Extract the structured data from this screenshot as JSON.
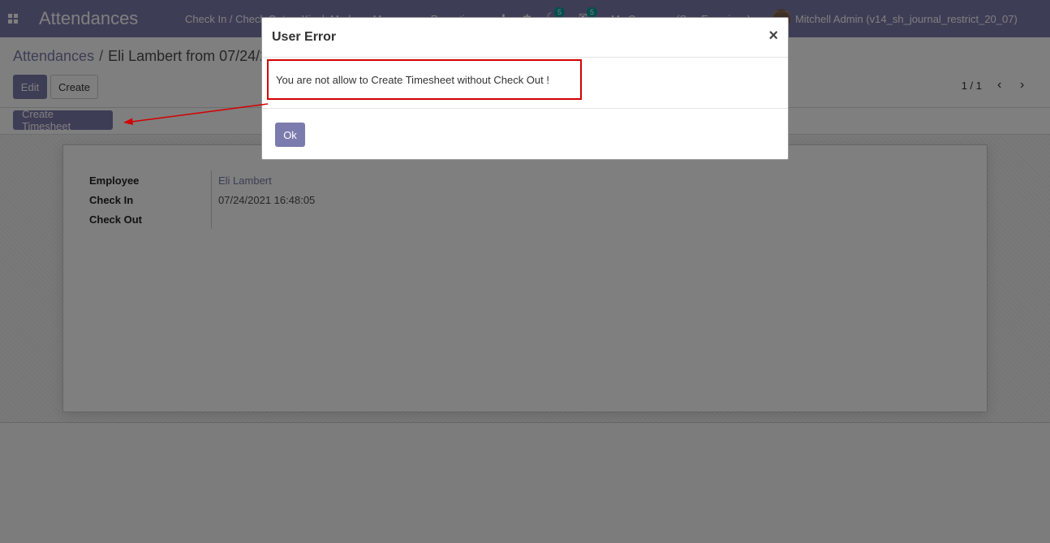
{
  "navbar": {
    "app_title": "Attendances",
    "menu": [
      "Check In / Check Out",
      "Kiosk Mode",
      "Manager",
      "Reporting"
    ],
    "activity_badge": "5",
    "messages_badge": "5",
    "company": "My Company (San Francisco)",
    "user": "Mitchell Admin (v14_sh_journal_restrict_20_07)"
  },
  "breadcrumb": {
    "parent": "Attendances",
    "separator": "/",
    "current": "Eli Lambert from 07/24/2021 16:48:05"
  },
  "buttons": {
    "edit": "Edit",
    "create": "Create",
    "create_timesheet": "Create Timesheet"
  },
  "pager": {
    "value": "1 / 1",
    "prev_icon": "chevron-left-icon",
    "next_icon": "chevron-right-icon"
  },
  "form": {
    "employee_label": "Employee",
    "employee_value": "Eli Lambert",
    "check_in_label": "Check In",
    "check_in_value": "07/24/2021 16:48:05",
    "check_out_label": "Check Out",
    "check_out_value": ""
  },
  "dialog": {
    "title": "User Error",
    "close_symbol": "×",
    "message": "You are not allow to Create Timesheet without Check Out !",
    "ok_label": "Ok"
  },
  "colors": {
    "brand": "#7c7bad",
    "badge": "#00a09d",
    "annotation": "#d40000"
  }
}
